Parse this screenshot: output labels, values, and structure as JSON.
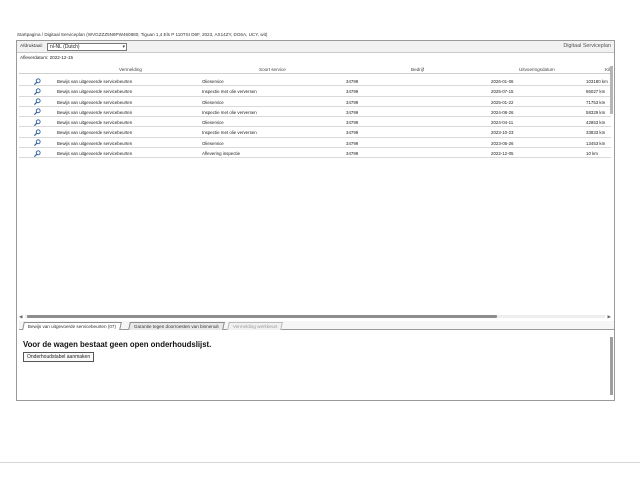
{
  "breadcrumb": "Startpagina / Digitaal Serviceplan (WVGZZZ5N6PW460880, Tiguan 1,4 Els P 110TSI D6F, 2023, AX14ZY, DG6A, UCY, wit)",
  "topbar": {
    "language_label": "Afdruktaal:",
    "language_value": "nl-NL (Dutch)",
    "panel_title": "Digitaal Serviceplan"
  },
  "delivery_date": "Afleverdatum: 2022-12-15",
  "table": {
    "headers": [
      "Vermelding",
      "Soort service",
      "Bedrijf",
      "Uitvoeringsdatum",
      "Kilo"
    ],
    "rows": [
      {
        "vermelding": "Bewijs van uitgevoerde servicebeurten",
        "soort": "Olieservice",
        "bedrijf": "34799",
        "datum": "2026-01-06",
        "km": "103180 km"
      },
      {
        "vermelding": "Bewijs van uitgevoerde servicebeurten",
        "soort": "Inspectie met olie verversen",
        "bedrijf": "34799",
        "datum": "2025-07-15",
        "km": "86027 km"
      },
      {
        "vermelding": "Bewijs van uitgevoerde servicebeurten",
        "soort": "Olieservice",
        "bedrijf": "34799",
        "datum": "2025-01-22",
        "km": "71753 km"
      },
      {
        "vermelding": "Bewijs van uitgevoerde servicebeurten",
        "soort": "Inspectie met olie verversen",
        "bedrijf": "34799",
        "datum": "2024-08-26",
        "km": "58329 km"
      },
      {
        "vermelding": "Bewijs van uitgevoerde servicebeurten",
        "soort": "Olieservice",
        "bedrijf": "34799",
        "datum": "2024-04-11",
        "km": "42853 km"
      },
      {
        "vermelding": "Bewijs van uitgevoerde servicebeurten",
        "soort": "Inspectie met olie verversen",
        "bedrijf": "34799",
        "datum": "2023-10-23",
        "km": "33833 km"
      },
      {
        "vermelding": "Bewijs van uitgevoerde servicebeurten",
        "soort": "Olieservice",
        "bedrijf": "34799",
        "datum": "2023-05-26",
        "km": "13453 km"
      },
      {
        "vermelding": "Bewijs van uitgevoerde servicebeurten",
        "soort": "Aflevering inspectie",
        "bedrijf": "34799",
        "datum": "2022-12-05",
        "km": "10 km"
      }
    ]
  },
  "tabs": [
    {
      "label": "Bewijs van uitgevoerde servicebeurten (07)",
      "state": "active"
    },
    {
      "label": "Garantie tegen doorroesten van binnenuit",
      "state": "normal"
    },
    {
      "label": "Vermelding werkbeurt",
      "state": "disabled"
    }
  ],
  "panel": {
    "message": "Voor de wagen bestaat geen open onderhoudslijst.",
    "button_label": "Onderhoudstabel aanmaken"
  },
  "icons": {
    "row_icon": "magnifier-icon",
    "select_icon": "chevron-down-icon"
  },
  "colors": {
    "magnifier": "#2f5fa0"
  }
}
